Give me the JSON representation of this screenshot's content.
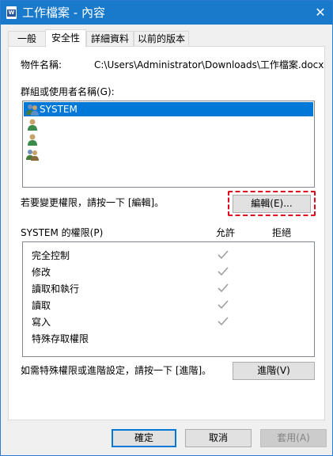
{
  "window": {
    "title": "工作檔案 - 內容",
    "app_icon_letter": "W",
    "close_glyph": "✕"
  },
  "tabs": [
    {
      "label": "一般",
      "active": false
    },
    {
      "label": "安全性",
      "active": true
    },
    {
      "label": "詳細資料",
      "active": false
    },
    {
      "label": "以前的版本",
      "active": false
    }
  ],
  "object": {
    "label": "物件名稱:",
    "value": "C:\\Users\\Administrator\\Downloads\\工作檔案.docx"
  },
  "groups": {
    "label": "群組或使用者名稱(G):",
    "items": [
      {
        "name": "SYSTEM",
        "icon": "group-users-icon",
        "selected": true
      },
      {
        "name": "",
        "icon": "user-icon",
        "selected": false
      },
      {
        "name": "",
        "icon": "user-icon",
        "selected": false
      },
      {
        "name": "",
        "icon": "group-users-icon",
        "selected": false
      }
    ]
  },
  "edit_hint": "若要變更權限，請按一下 [編輯]。",
  "edit_button": "編輯(E)...",
  "permissions": {
    "label": "SYSTEM 的權限(P)",
    "allow_header": "允許",
    "deny_header": "拒絕",
    "rows": [
      {
        "name": "完全控制",
        "allow": true,
        "deny": false
      },
      {
        "name": "修改",
        "allow": true,
        "deny": false
      },
      {
        "name": "讀取和執行",
        "allow": true,
        "deny": false
      },
      {
        "name": "讀取",
        "allow": true,
        "deny": false
      },
      {
        "name": "寫入",
        "allow": true,
        "deny": false
      },
      {
        "name": "特殊存取權限",
        "allow": false,
        "deny": false
      }
    ]
  },
  "advanced_hint": "如需特殊權限或進階設定，請按一下 [進階]。",
  "advanced_button": "進階(V)",
  "footer": {
    "ok": "確定",
    "cancel": "取消",
    "apply": "套用(A)"
  },
  "colors": {
    "titlebar": "#1979ca",
    "selection": "#0078d7",
    "highlight": "#e0071b",
    "checkmark_disabled": "#a0a0a0"
  }
}
